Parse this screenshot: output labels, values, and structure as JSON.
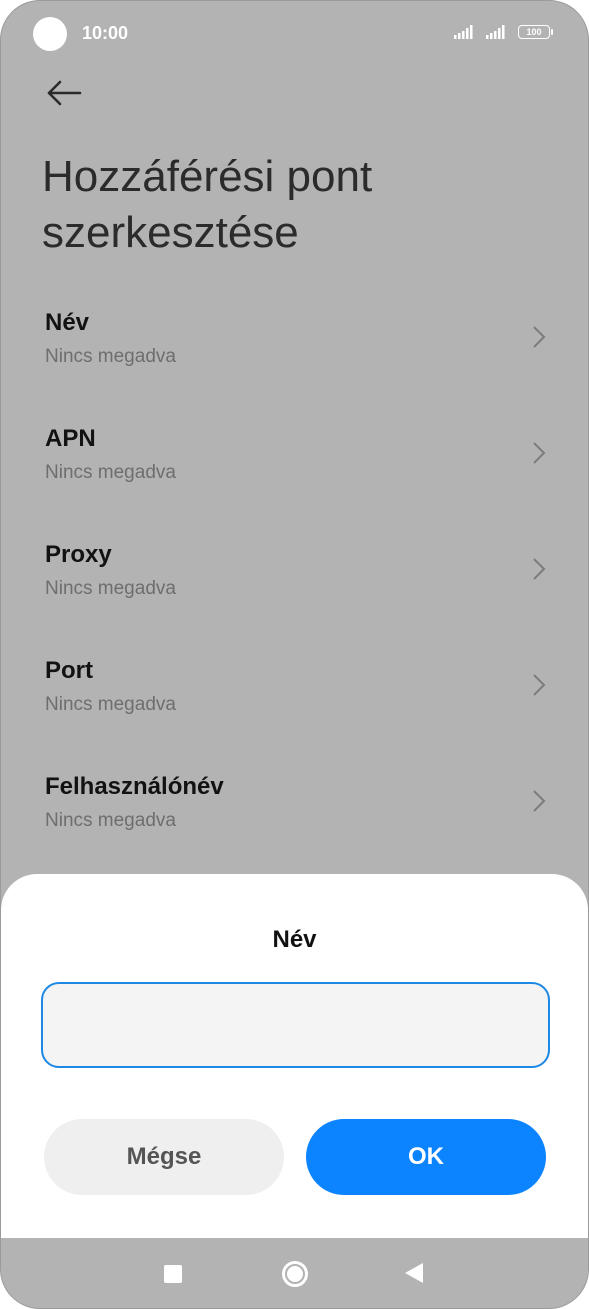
{
  "status_bar": {
    "time": "10:00",
    "battery": "100",
    "icons": [
      "signal-icon",
      "signal-icon",
      "battery-icon"
    ]
  },
  "header": {
    "back_icon": "arrow-left-icon",
    "title": "Hozzáférési pont szerkesztése"
  },
  "list": {
    "items": [
      {
        "label": "Név",
        "value": "Nincs megadva"
      },
      {
        "label": "APN",
        "value": "Nincs megadva"
      },
      {
        "label": "Proxy",
        "value": "Nincs megadva"
      },
      {
        "label": "Port",
        "value": "Nincs megadva"
      },
      {
        "label": "Felhasználónév",
        "value": "Nincs megadva"
      }
    ]
  },
  "dialog": {
    "title": "Név",
    "input_value": "",
    "cancel_label": "Mégse",
    "ok_label": "OK"
  },
  "colors": {
    "accent": "#0d84ff",
    "input_border": "#1e88e5",
    "scrim": "#b3b3b3"
  }
}
